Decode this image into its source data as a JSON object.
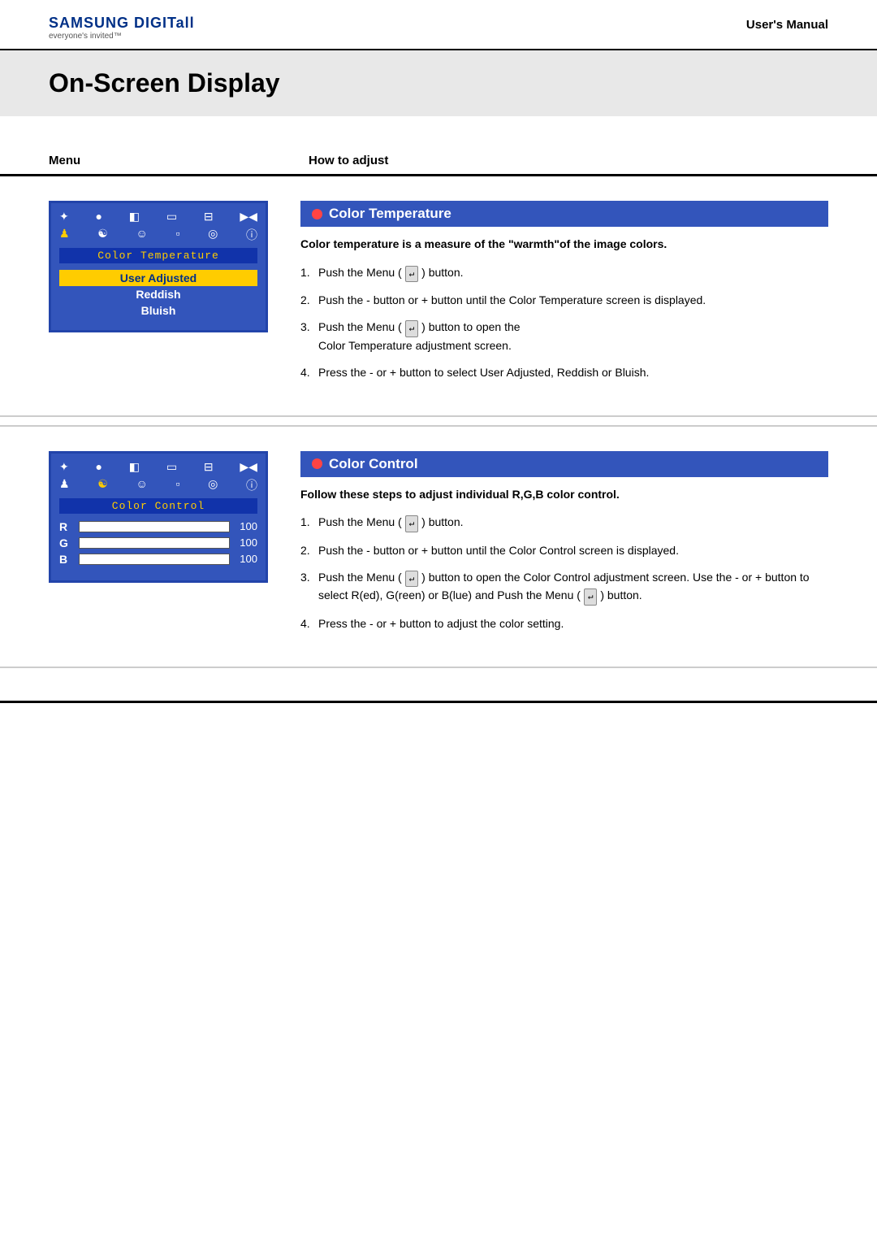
{
  "header": {
    "logo_line1": "SAMSUNG DIGITall",
    "logo_line2": "everyone's invited™",
    "manual_title": "User's Manual"
  },
  "page": {
    "title": "On-Screen Display"
  },
  "columns": {
    "menu_label": "Menu",
    "how_label": "How to adjust"
  },
  "section1": {
    "heading": "Color Temperature",
    "subtitle": "Color temperature is a measure of the \"warmth\"of the image colors.",
    "osd_title": "Color Temperature",
    "osd_items": [
      "User Adjusted",
      "Reddish",
      "Bluish"
    ],
    "steps": [
      "Push the Menu (  ) button.",
      "Push the - button or + button until the Color Temperature screen is displayed.",
      "Push the Menu (  ) button to open the Color Temperature adjustment screen.",
      "Press the - or + button to select User Adjusted,  Reddish or Bluish."
    ]
  },
  "section2": {
    "heading": "Color Control",
    "subtitle": "Follow these steps to adjust individual R,G,B color control.",
    "osd_title": "Color Control",
    "osd_rows": [
      {
        "label": "R",
        "value": "100"
      },
      {
        "label": "G",
        "value": "100"
      },
      {
        "label": "B",
        "value": "100"
      }
    ],
    "steps": [
      "Push the Menu (  ) button.",
      "Push the - button or + button until the Color Control screen is displayed.",
      "Push the Menu (  ) button to open the Color Control adjustment screen. Use the - or + button to select  R(ed), G(reen) or B(lue) and Push the Menu (  ) button.",
      "Press the - or + button to adjust the color setting."
    ]
  }
}
